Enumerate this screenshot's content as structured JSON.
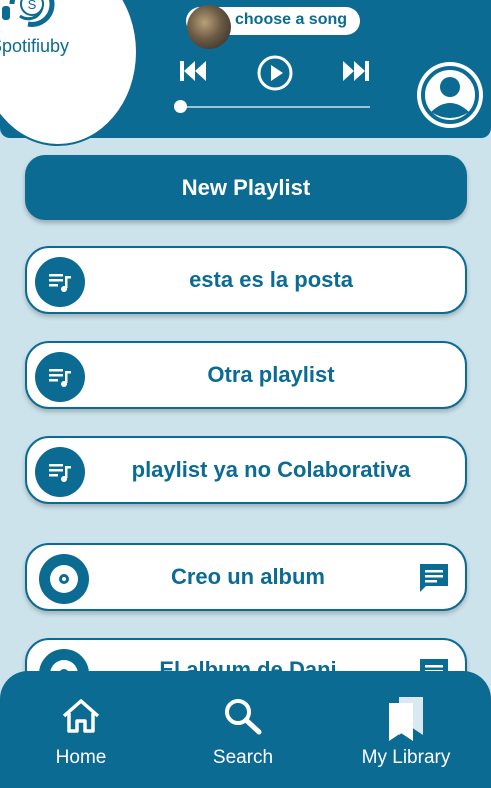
{
  "brand": {
    "name": "Spotifiuby",
    "logo_letter": "S"
  },
  "player": {
    "current_song": "choose a song",
    "progress": 0
  },
  "main": {
    "new_playlist_label": "New Playlist",
    "items": [
      {
        "type": "playlist",
        "label": "esta es la posta",
        "icon": "playlist-music-icon"
      },
      {
        "type": "playlist",
        "label": "Otra playlist",
        "icon": "playlist-music-icon"
      },
      {
        "type": "playlist",
        "label": "playlist ya no Colaborativa",
        "icon": "playlist-music-icon"
      },
      {
        "type": "album",
        "label": "Creo un album",
        "icon": "album-disc-icon",
        "action_icon": "chat-icon"
      },
      {
        "type": "album",
        "label": "El album de Dani",
        "icon": "album-disc-icon",
        "action_icon": "chat-icon"
      }
    ]
  },
  "nav": {
    "home": {
      "label": "Home",
      "icon": "home-icon"
    },
    "search": {
      "label": "Search",
      "icon": "search-icon"
    },
    "library": {
      "label": "My Library",
      "icon": "library-icon"
    }
  },
  "colors": {
    "primary": "#0c6b93",
    "background": "#cde3ec",
    "surface": "#ffffff"
  }
}
